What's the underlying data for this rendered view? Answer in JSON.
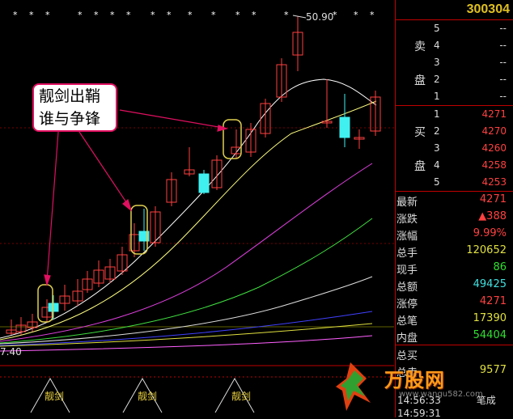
{
  "chart": {
    "high_label": "50.90",
    "low_label": "7.40",
    "callout_line1": "靓剑出鞘",
    "callout_line2": "谁与争锋",
    "signal_label": "靓剑"
  },
  "panel": {
    "code": "300304",
    "sell_label_1": "卖",
    "sell_label_2": "盘",
    "buy_label_1": "买",
    "buy_label_2": "盘",
    "sell": [
      {
        "level": "5",
        "price": "--"
      },
      {
        "level": "4",
        "price": "--"
      },
      {
        "level": "3",
        "price": "--"
      },
      {
        "level": "2",
        "price": "--"
      },
      {
        "level": "1",
        "price": "--"
      }
    ],
    "buy": [
      {
        "level": "1",
        "price": "4271"
      },
      {
        "level": "2",
        "price": "4270"
      },
      {
        "level": "3",
        "price": "4260"
      },
      {
        "level": "4",
        "price": "4258"
      },
      {
        "level": "5",
        "price": "4253"
      }
    ],
    "stats": [
      {
        "key": "最新",
        "value": "4271",
        "color": "red"
      },
      {
        "key": "涨跌",
        "value": "▲388",
        "color": "red"
      },
      {
        "key": "涨幅",
        "value": "9.99%",
        "color": "red"
      },
      {
        "key": "总手",
        "value": "120652",
        "color": "yellow"
      },
      {
        "key": "现手",
        "value": "86",
        "color": "green"
      },
      {
        "key": "总额",
        "value": "49425",
        "color": "cyan"
      },
      {
        "key": "涨停",
        "value": "4271",
        "color": "red"
      },
      {
        "key": "总笔",
        "value": "17390",
        "color": "yellow"
      },
      {
        "key": "内盘",
        "value": "54404",
        "color": "green"
      },
      {
        "key": "总买",
        "value": "",
        "color": "yellow"
      },
      {
        "key": "总卖",
        "value": "9577",
        "color": "yellow"
      }
    ],
    "time": "14:56:33",
    "time2": "14:59:31",
    "foot_suffix": "笔成"
  },
  "watermark": {
    "text": "万股网",
    "url": "www.wangu582.com"
  }
}
